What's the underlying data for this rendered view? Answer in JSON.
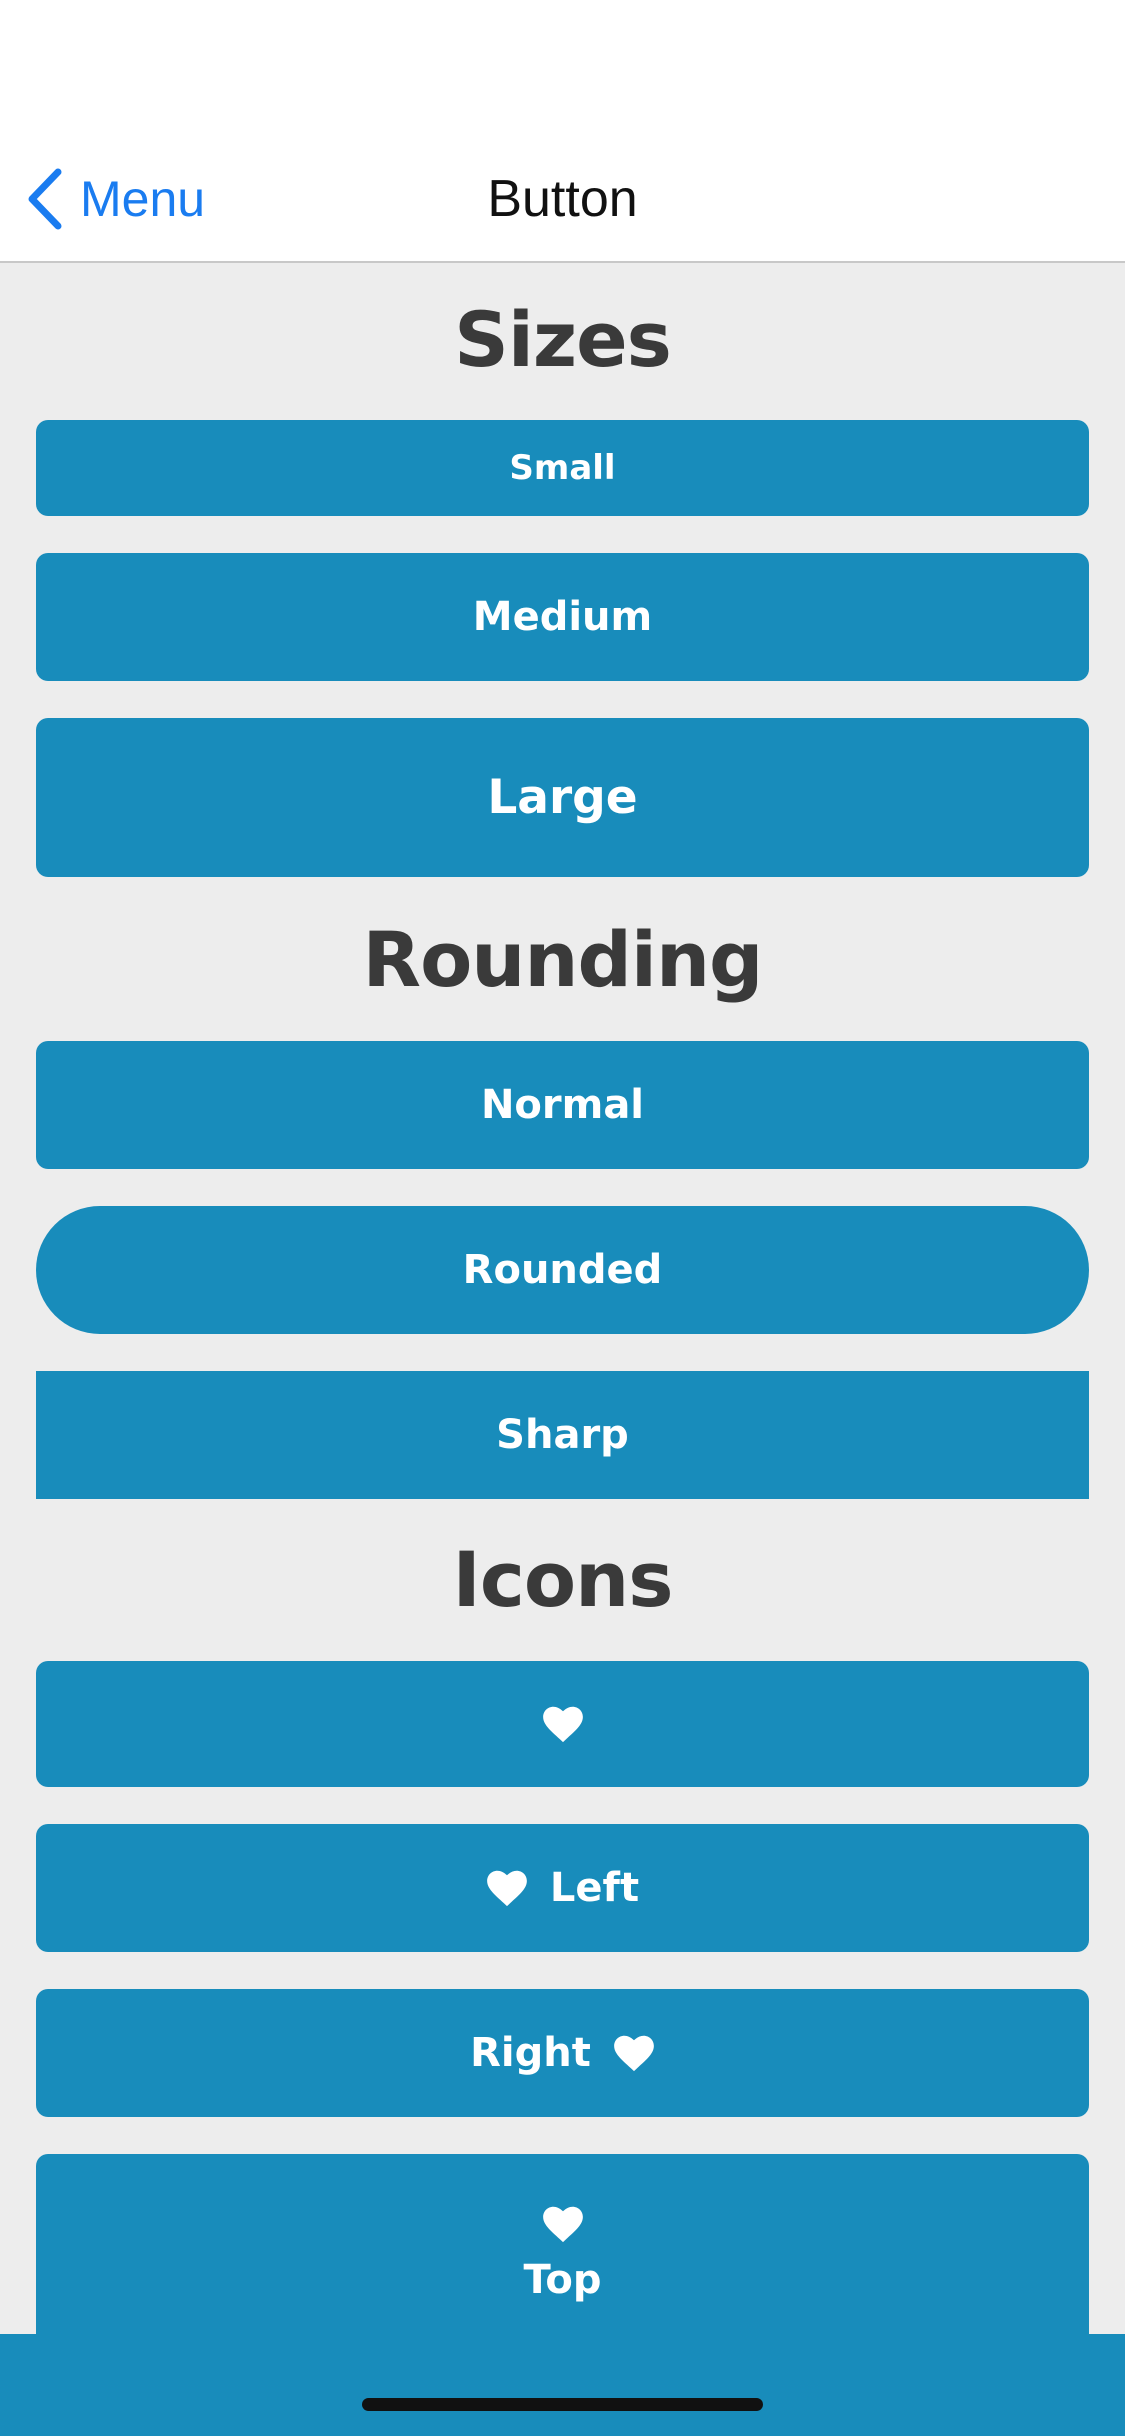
{
  "nav": {
    "back_label": "Menu",
    "title": "Button"
  },
  "sections": {
    "sizes": {
      "title": "Sizes",
      "small": "Small",
      "medium": "Medium",
      "large": "Large"
    },
    "rounding": {
      "title": "Rounding",
      "normal": "Normal",
      "rounded": "Rounded",
      "sharp": "Sharp"
    },
    "icons": {
      "title": "Icons",
      "left": "Left",
      "right": "Right",
      "top": "Top"
    }
  },
  "colors": {
    "button": "#188cbb",
    "accent": "#1a7cf0",
    "background": "#ededed"
  },
  "icons": {
    "back": "chevron-left-icon",
    "button_icon": "heart-icon"
  }
}
